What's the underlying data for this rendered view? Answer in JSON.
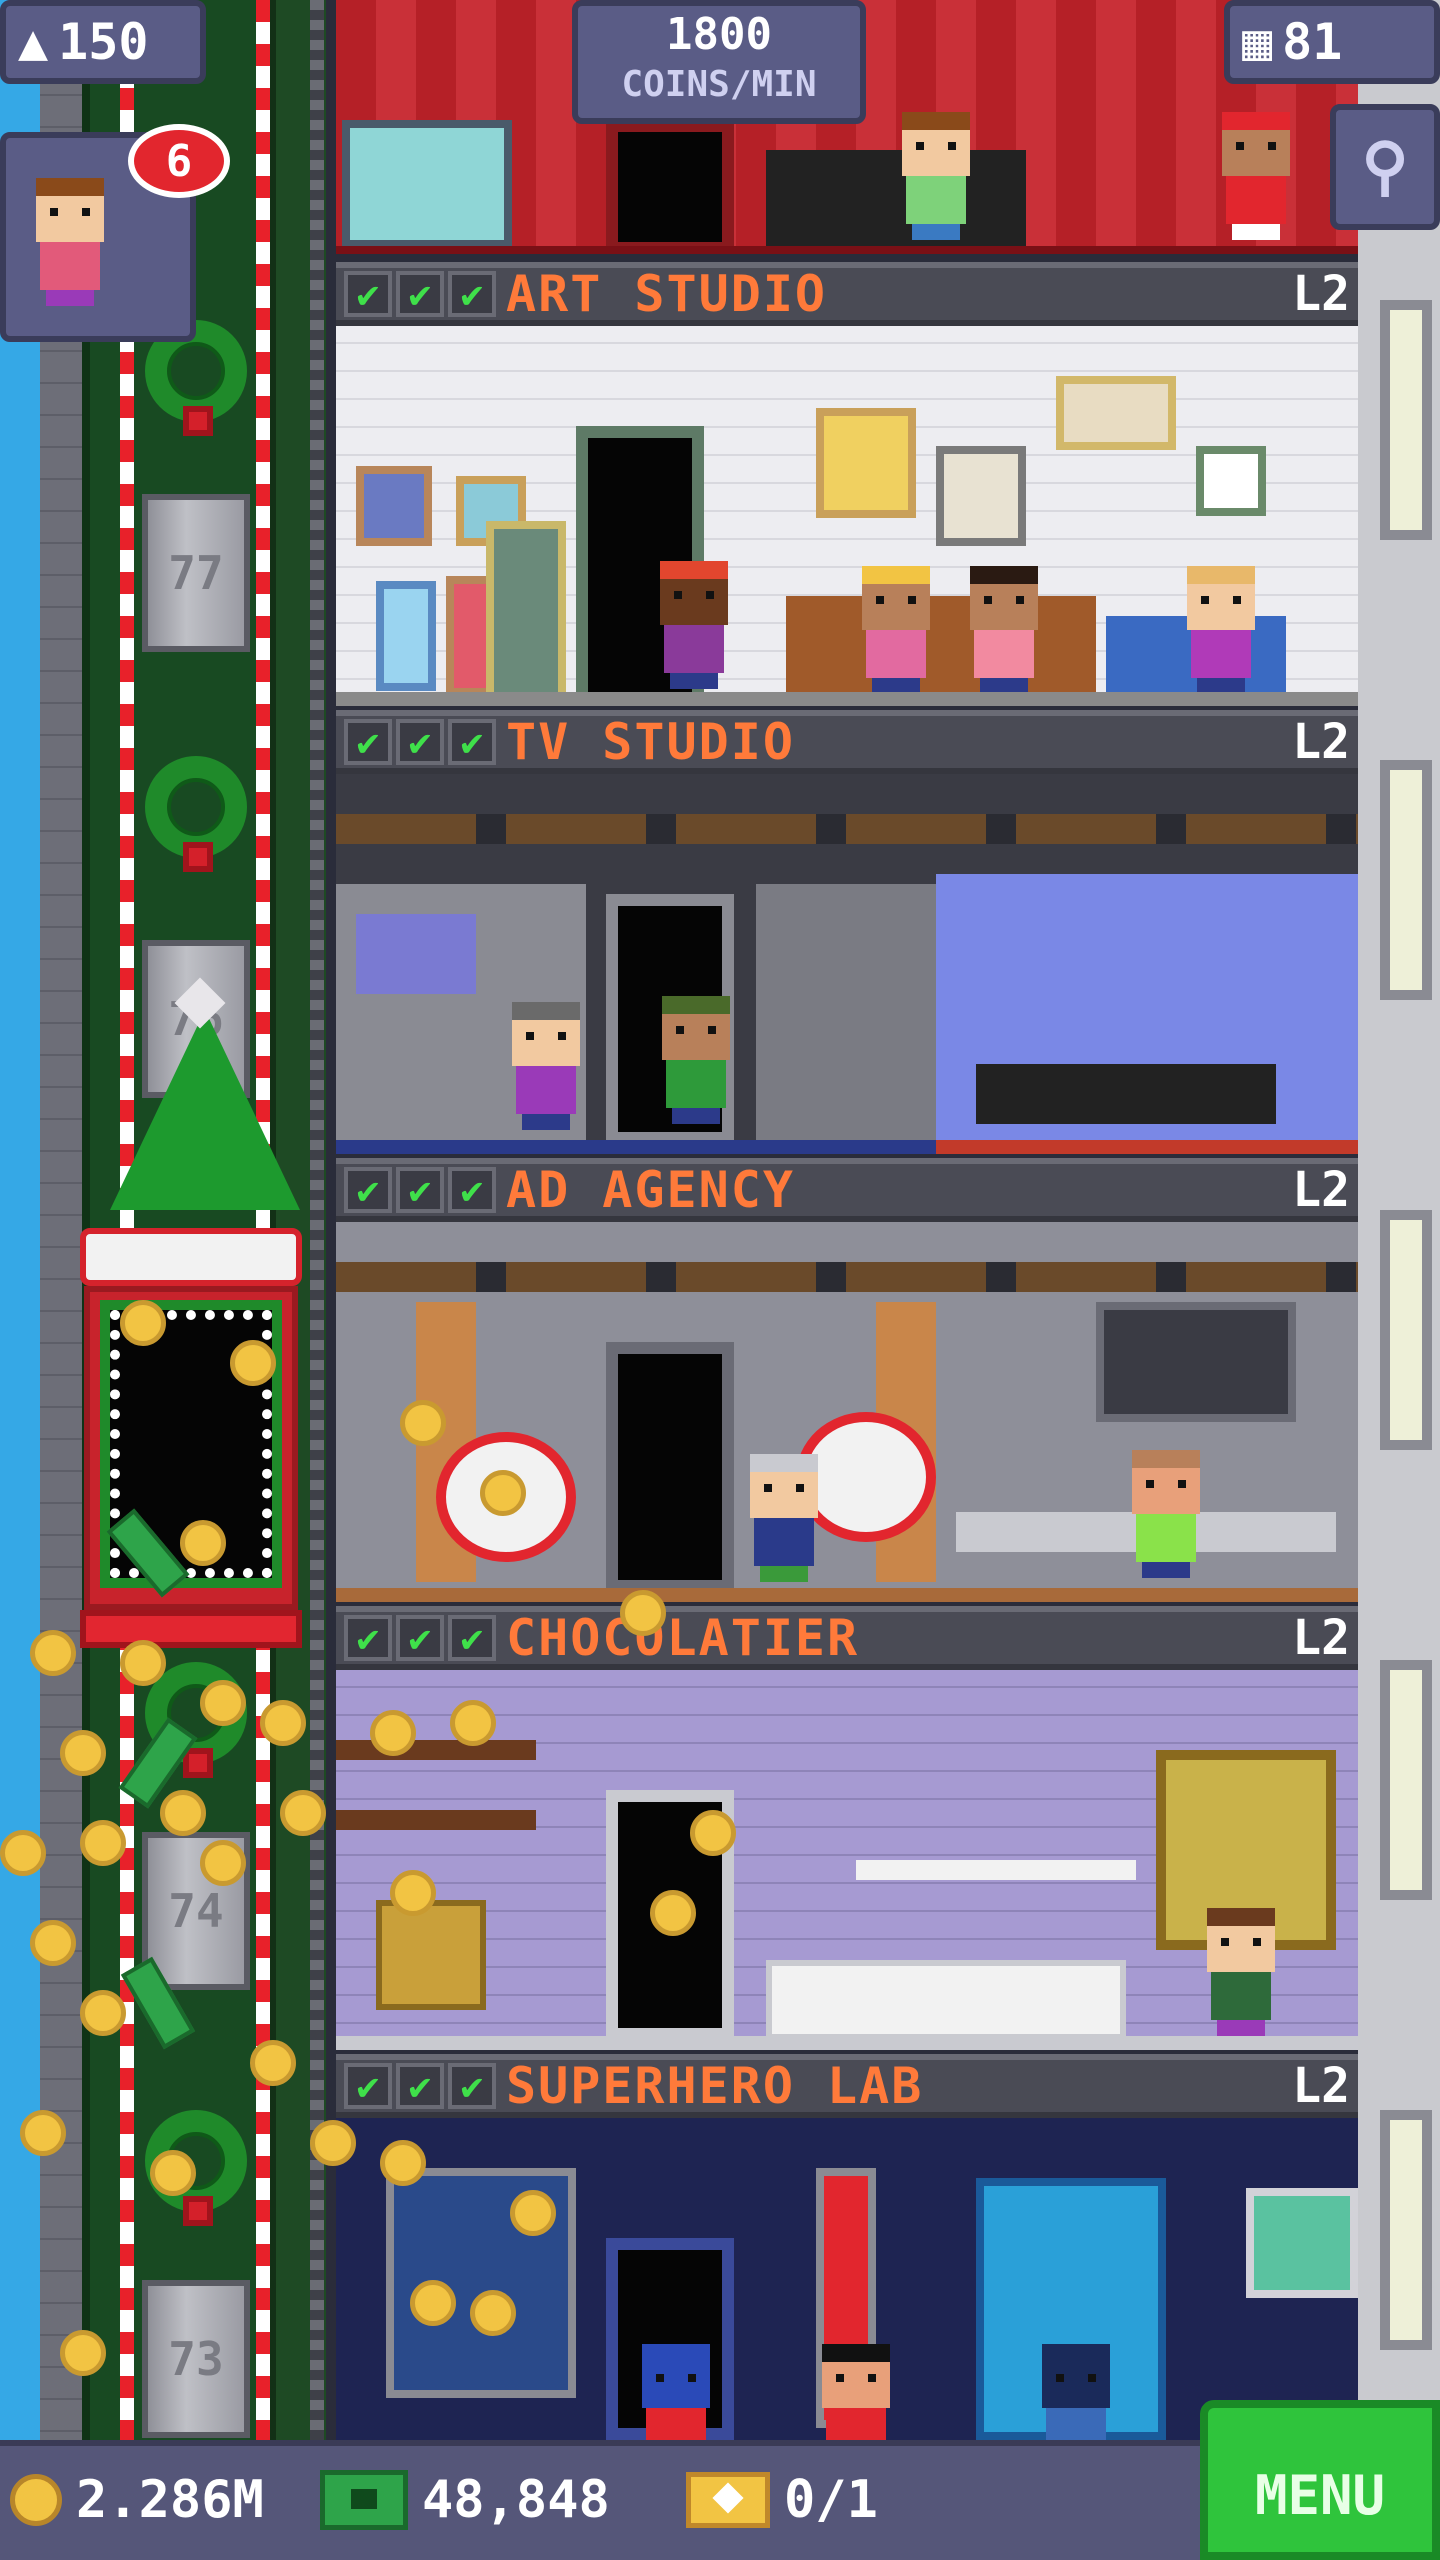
{
  "hud": {
    "population": "150",
    "coins_per_min_value": "1800",
    "coins_per_min_unit": "COINS/MIN",
    "floor_count": "81",
    "visitor_badge": "6"
  },
  "shaft": {
    "floor_numbers": [
      "77",
      "76",
      "74",
      "73"
    ]
  },
  "rooms": [
    {
      "name": "ART STUDIO",
      "level": "L2",
      "checks": "✔"
    },
    {
      "name": "TV STUDIO",
      "level": "L2",
      "checks": "✔"
    },
    {
      "name": "AD AGENCY",
      "level": "L2",
      "checks": "✔"
    },
    {
      "name": "CHOCOLATIER",
      "level": "L2",
      "checks": "✔"
    },
    {
      "name": "SUPERHERO LAB",
      "level": "L2",
      "checks": "✔"
    }
  ],
  "bottom_bar": {
    "coins": "2.286M",
    "bux": "48,848",
    "tickets": "0/1",
    "menu_label": "MENU"
  },
  "colors": {
    "room_name": "#ff7a3a",
    "check": "#3fe04a",
    "menu": "#2fc43c",
    "hud_box": "#5a5c86"
  }
}
